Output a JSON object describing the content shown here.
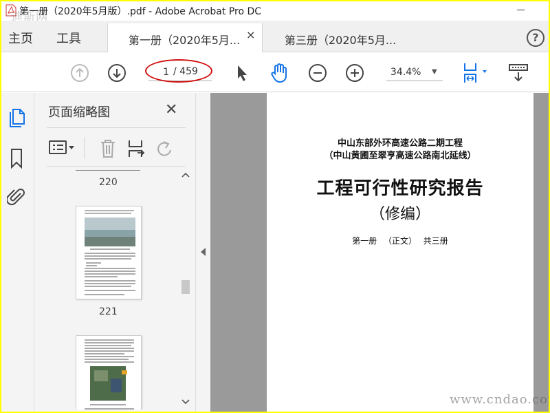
{
  "window": {
    "title": "第一册（2020年5月版）.pdf - Adobe Acrobat Pro DC",
    "watermark_top": "迪斯网"
  },
  "menu": {
    "home": "主页",
    "tools": "工具"
  },
  "tabs": [
    {
      "label": "第一册（2020年5月...",
      "close": "×"
    },
    {
      "label": "第三册（2020年5月..."
    }
  ],
  "help": "?",
  "toolbar": {
    "page_current": "1",
    "page_total": "/ 459",
    "zoom": "34.4%",
    "icons": [
      "prev-page-icon",
      "next-page-icon",
      "select-pointer-icon",
      "hand-tool-icon",
      "zoom-out-icon",
      "zoom-in-icon",
      "fit-page-icon",
      "scroll-mode-icon"
    ],
    "highlight_color": "#d01010"
  },
  "rail": {
    "icons": [
      "page-thumbnails-icon",
      "bookmark-icon",
      "attachment-icon"
    ],
    "accent": "#1473e6"
  },
  "thumbnails_panel": {
    "title": "页面缩略图",
    "close": "✕",
    "pages": [
      "220",
      "221"
    ]
  },
  "document": {
    "line1": "中山东部外环高速公路二期工程",
    "line2": "（中山黄圃至翠亨高速公路南北延线）",
    "title": "工程可行性研究报告",
    "subtitle": "（修编）",
    "volume": "第一册 （正文） 共三册"
  },
  "watermark_bottom": "www.cndao.com",
  "colors": {
    "frame": "#ffff00",
    "doc_bg": "#9a9a9a"
  }
}
